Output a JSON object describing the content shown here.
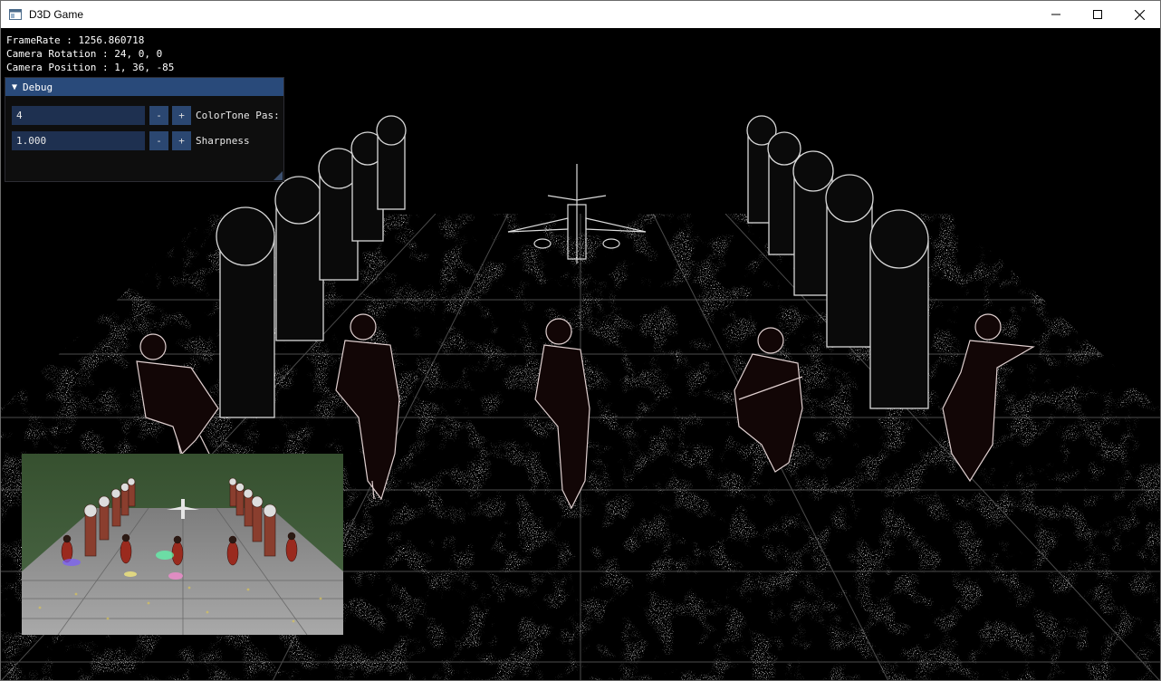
{
  "window": {
    "title": "D3D Game",
    "icons": {
      "app": "app-window-icon",
      "minimize": "minimize-icon",
      "maximize": "maximize-icon",
      "close": "close-icon"
    }
  },
  "hud": {
    "framerate": "FrameRate : 1256.860718",
    "camera_rotation": "Camera Rotation : 24, 0, 0",
    "camera_position": "Camera Position : 1, 36, -85"
  },
  "debug": {
    "title": "Debug",
    "collapse_icon": "triangle-down-icon",
    "rows": [
      {
        "value": "4",
        "minus": "-",
        "plus": "+",
        "label": "ColorTone Pas:"
      },
      {
        "value": "1.000",
        "minus": "-",
        "plus": "+",
        "label": "Sharpness"
      }
    ]
  },
  "colors": {
    "titlebar_bg": "#ffffff",
    "viewport_bg": "#000000",
    "debug_header": "#294a7a",
    "debug_field": "#1e3050",
    "debug_button": "#2b4771",
    "preview_sky": "#3f5a3c",
    "preview_floor": "#8c8c8c"
  }
}
